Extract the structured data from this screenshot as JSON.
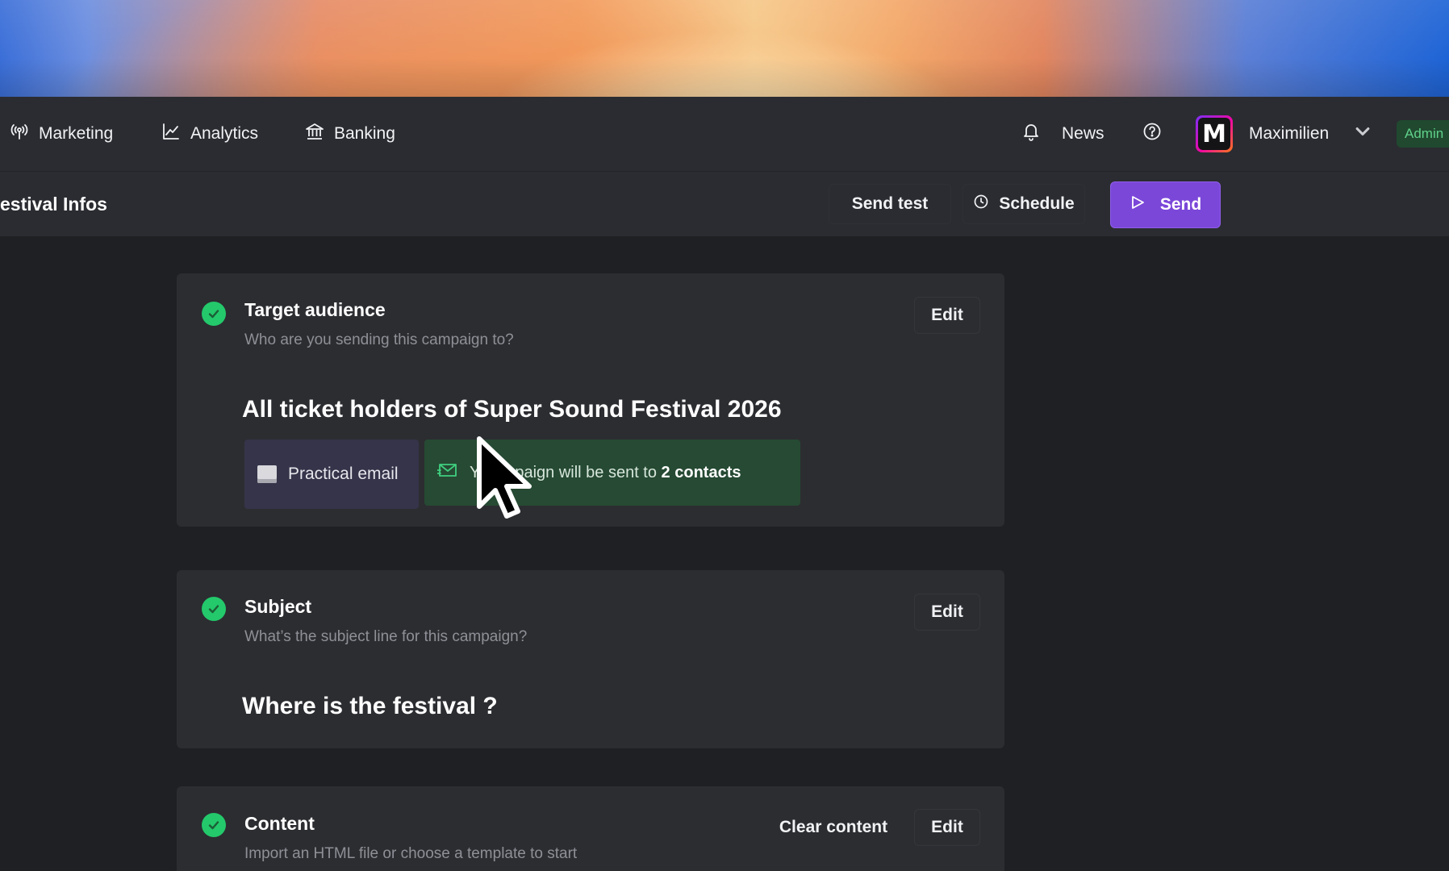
{
  "nav": {
    "items": [
      {
        "label": "Marketing",
        "icon": "broadcast-icon"
      },
      {
        "label": "Analytics",
        "icon": "line-chart-icon"
      },
      {
        "label": "Banking",
        "icon": "bank-icon"
      }
    ],
    "news_label": "News",
    "user_initial": "M",
    "user_name": "Maximilien",
    "role_badge": "Admin"
  },
  "toolbar": {
    "title": "estival Infos",
    "send_test_label": "Send test",
    "schedule_label": "Schedule",
    "send_label": "Send"
  },
  "sections": {
    "audience": {
      "title": "Target audience",
      "description": "Who are you sending this campaign to?",
      "value": "All ticket holders of Super Sound Festival 2026",
      "edit_label": "Edit",
      "email_chip": "Practical email",
      "contacts_prefix": "Y",
      "contacts_middle": " campaign will be sent to ",
      "contacts_count": "2 contacts"
    },
    "subject": {
      "title": "Subject",
      "description": "What’s the subject line for this campaign?",
      "value": "Where is the festival ?",
      "edit_label": "Edit"
    },
    "content": {
      "title": "Content",
      "description": "Import an HTML file or choose a template to start",
      "clear_label": "Clear content",
      "edit_label": "Edit"
    }
  },
  "colors": {
    "accent": "#7b47d9",
    "success": "#23c96b",
    "admin_badge_text": "#5fd18a"
  }
}
